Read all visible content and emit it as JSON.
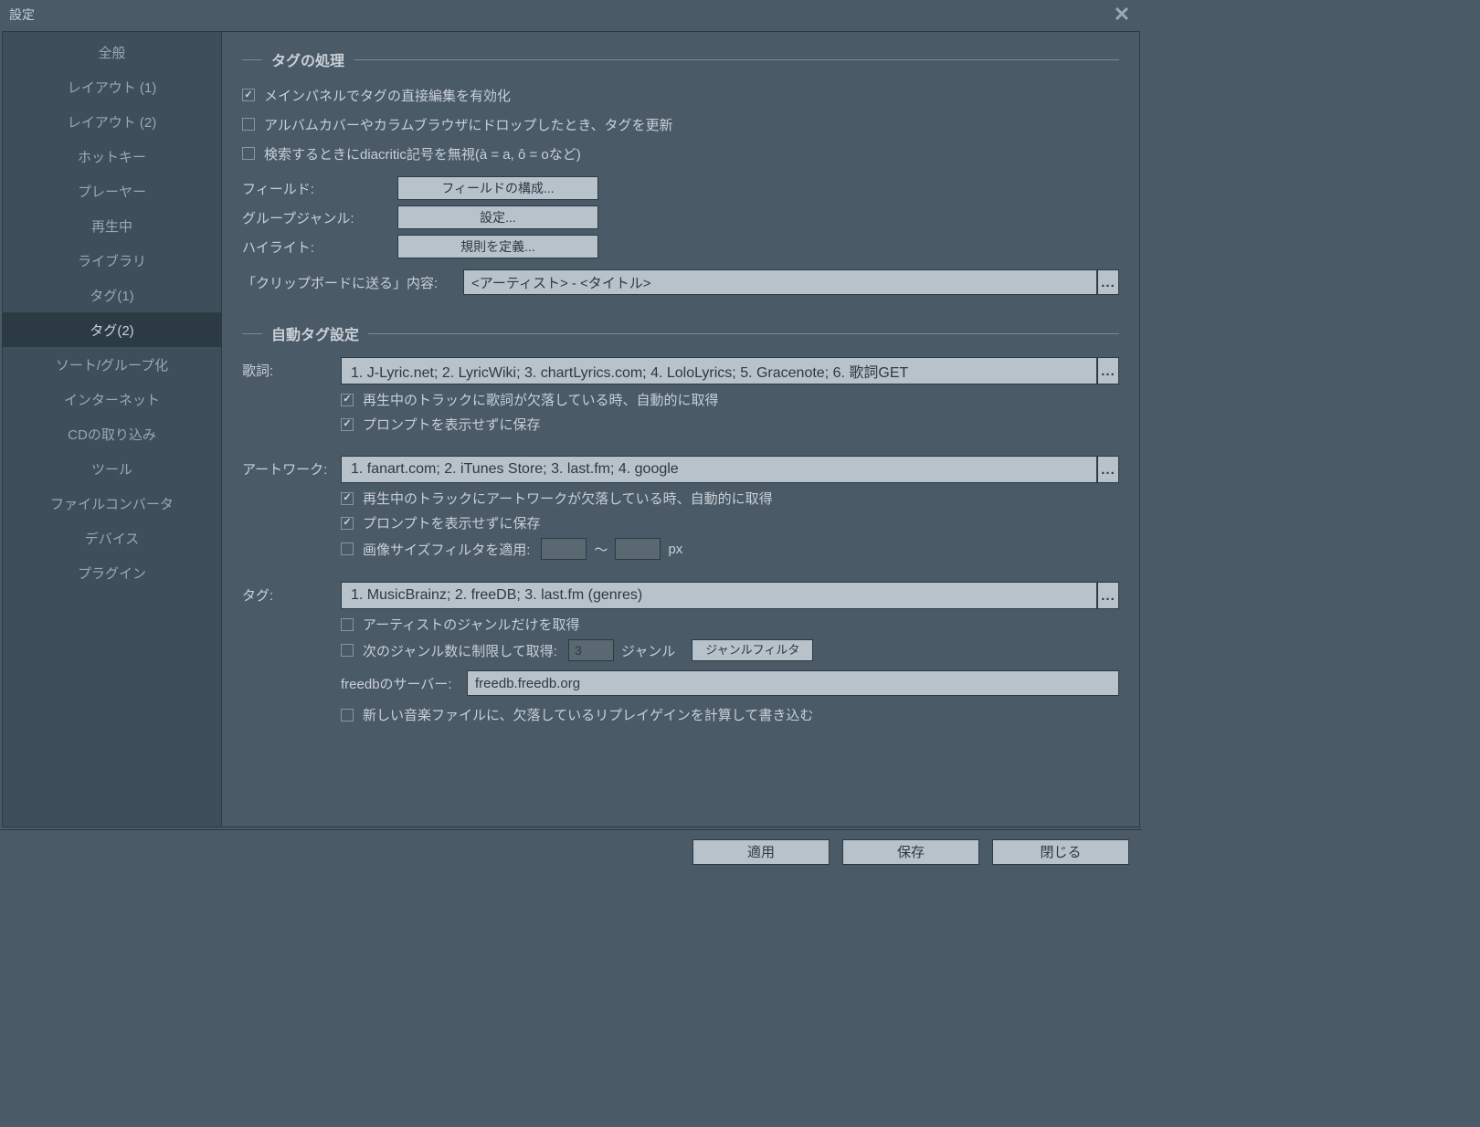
{
  "title": "設定",
  "sidebar": {
    "items": [
      {
        "label": "全般"
      },
      {
        "label": "レイアウト (1)"
      },
      {
        "label": "レイアウト (2)"
      },
      {
        "label": "ホットキー"
      },
      {
        "label": "プレーヤー"
      },
      {
        "label": "再生中"
      },
      {
        "label": "ライブラリ"
      },
      {
        "label": "タグ(1)"
      },
      {
        "label": "タグ(2)"
      },
      {
        "label": "ソート/グループ化"
      },
      {
        "label": "インターネット"
      },
      {
        "label": "CDの取り込み"
      },
      {
        "label": "ツール"
      },
      {
        "label": "ファイルコンバータ"
      },
      {
        "label": "デバイス"
      },
      {
        "label": "プラグイン"
      }
    ],
    "active_index": 8
  },
  "sections": {
    "tag_handling": {
      "title": "タグの処理",
      "enable_direct_edit": "メインパネルでタグの直接編集を有効化",
      "update_on_drop": "アルバムカバーやカラムブラウザにドロップしたとき、タグを更新",
      "ignore_diacritic": "検索するときにdiacritic記号を無視(à = a, ô = oなど)",
      "field_label": "フィールド:",
      "field_button": "フィールドの構成...",
      "group_genre_label": "グループジャンル:",
      "group_genre_button": "設定...",
      "highlight_label": "ハイライト:",
      "highlight_button": "規則を定義...",
      "clipboard_label": "「クリップボードに送る」内容:",
      "clipboard_value": "<アーティスト> - <タイトル>"
    },
    "auto_tag": {
      "title": "自動タグ設定",
      "lyrics_label": "歌詞:",
      "lyrics_providers": "1. J-Lyric.net; 2. LyricWiki; 3. chartLyrics.com; 4. LoloLyrics; 5. Gracenote; 6. 歌詞GET",
      "lyrics_auto": "再生中のトラックに歌詞が欠落している時、自動的に取得",
      "lyrics_save_noprompt": "プロンプトを表示せずに保存",
      "artwork_label": "アートワーク:",
      "artwork_providers": "1. fanart.com; 2. iTunes Store; 3. last.fm; 4. google",
      "artwork_auto": "再生中のトラックにアートワークが欠落している時、自動的に取得",
      "artwork_save_noprompt": "プロンプトを表示せずに保存",
      "image_size_filter": "画像サイズフィルタを適用:",
      "size_tilde": "～",
      "size_px": "px",
      "size_min": "",
      "size_max": "",
      "tag_label": "タグ:",
      "tag_providers": "1. MusicBrainz; 2. freeDB; 3. last.fm (genres)",
      "artist_genre_only": "アーティストのジャンルだけを取得",
      "limit_genre_count": "次のジャンル数に制限して取得:",
      "limit_genre_value": "3",
      "genre_unit": "ジャンル",
      "genre_filter_button": "ジャンルフィルタ",
      "freedb_label": "freedbのサーバー:",
      "freedb_value": "freedb.freedb.org",
      "replaygain": "新しい音楽ファイルに、欠落しているリプレイゲインを計算して書き込む"
    }
  },
  "footer": {
    "apply": "適用",
    "save": "保存",
    "close": "閉じる"
  }
}
